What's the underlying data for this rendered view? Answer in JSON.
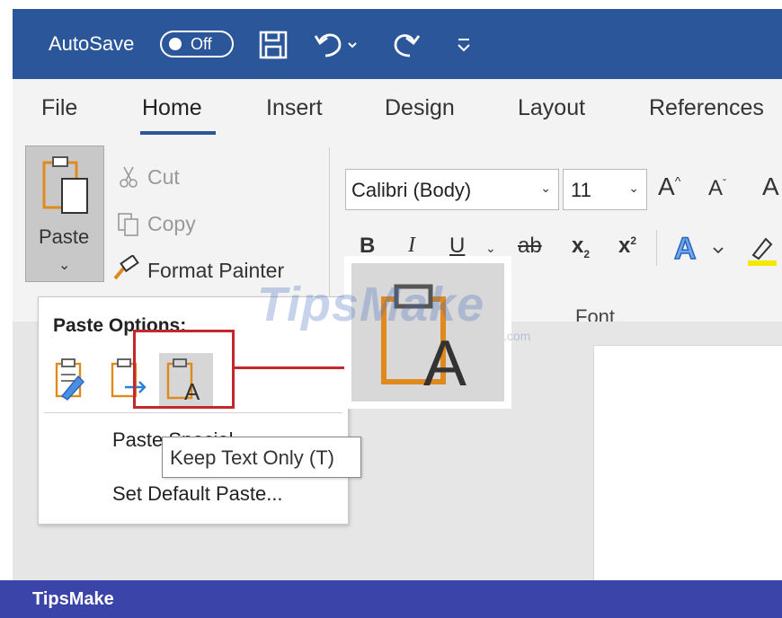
{
  "titlebar": {
    "autosave_label": "AutoSave",
    "autosave_state": "Off",
    "icons": [
      "save-icon",
      "undo-icon",
      "redo-icon",
      "customize-qat-icon"
    ]
  },
  "tabs": [
    {
      "label": "File"
    },
    {
      "label": "Home",
      "active": true
    },
    {
      "label": "Insert"
    },
    {
      "label": "Design"
    },
    {
      "label": "Layout"
    },
    {
      "label": "References"
    }
  ],
  "clipboard": {
    "paste_label": "Paste",
    "cut_label": "Cut",
    "copy_label": "Copy",
    "format_painter_label": "Format Painter"
  },
  "font": {
    "family": "Calibri (Body)",
    "size": "11",
    "group_label": "Font",
    "bold": "B",
    "italic": "I",
    "underline": "U",
    "strikethrough": "ab",
    "subscript": "x",
    "superscript": "x"
  },
  "paste_menu": {
    "title": "Paste Options:",
    "paste_special": "Paste Special...",
    "set_default": "Set Default Paste...",
    "tooltip": "Keep Text Only (T)"
  },
  "watermark": {
    "text": "TipsMake",
    "suffix": ".com"
  },
  "footer": {
    "brand": "TipsMake"
  },
  "colors": {
    "titlebar": "#2b579a",
    "highlight": "#c2282e",
    "footer": "#3b44a8",
    "clipboard_orange": "#e08a1e"
  }
}
